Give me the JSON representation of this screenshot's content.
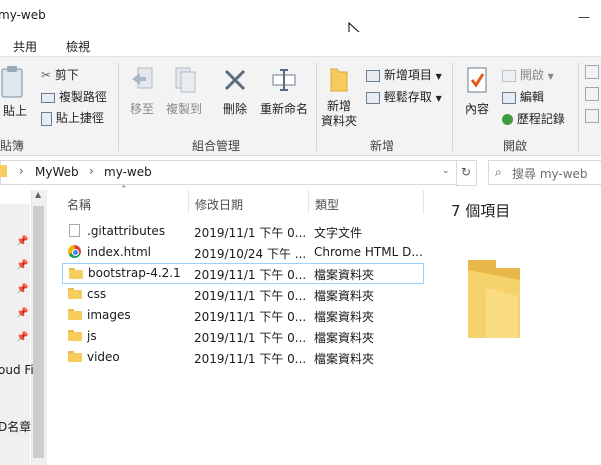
{
  "window": {
    "title": "my-web",
    "minimize": "—",
    "cursor": "arrow-cursor"
  },
  "menu": {
    "share": "共用",
    "view": "檢視"
  },
  "ribbon": {
    "clipboard": {
      "paste": "貼上",
      "cut": "剪下",
      "copy_path": "複製路徑",
      "paste_shortcut": "貼上捷徑",
      "group_label": "貼簿"
    },
    "organize": {
      "move_to": "移至",
      "copy_to": "複製到",
      "delete": "刪除",
      "rename": "重新命名",
      "group_label": "組合管理"
    },
    "new": {
      "new_folder_line1": "新增",
      "new_folder_line2": "資料夾",
      "new_item": "新增項目",
      "easy_access": "輕鬆存取",
      "group_label": "新增"
    },
    "open": {
      "properties": "內容",
      "open": "開啟",
      "edit": "編輯",
      "history": "歷程記錄",
      "group_label": "開啟"
    }
  },
  "address": {
    "crumbs": [
      "MyWeb",
      "my-web"
    ],
    "search_placeholder": "搜尋 my-web"
  },
  "sidebar": {
    "partial_labels": [
      "oud Fi",
      "D名章"
    ]
  },
  "columns": {
    "name": "名稱",
    "date": "修改日期",
    "type": "類型"
  },
  "files": [
    {
      "name": ".gitattributes",
      "date": "2019/11/1 下午 0...",
      "type": "文字文件",
      "icon": "text-file-icon"
    },
    {
      "name": "index.html",
      "date": "2019/10/24 下午 ...",
      "type": "Chrome HTML D...",
      "icon": "chrome-html-icon"
    },
    {
      "name": "bootstrap-4.2.1",
      "date": "2019/11/1 下午 0...",
      "type": "檔案資料夾",
      "icon": "folder-icon"
    },
    {
      "name": "css",
      "date": "2019/11/1 下午 0...",
      "type": "檔案資料夾",
      "icon": "folder-icon"
    },
    {
      "name": "images",
      "date": "2019/11/1 下午 0...",
      "type": "檔案資料夾",
      "icon": "folder-icon"
    },
    {
      "name": "js",
      "date": "2019/11/1 下午 0...",
      "type": "檔案資料夾",
      "icon": "folder-icon"
    },
    {
      "name": "video",
      "date": "2019/11/1 下午 0...",
      "type": "檔案資料夾",
      "icon": "folder-icon"
    }
  ],
  "preview": {
    "count": "7 個項目"
  },
  "colors": {
    "folder": "#f6cd5c",
    "selection_border": "#99d1ff",
    "ribbon_bg": "#f3f3f3"
  }
}
